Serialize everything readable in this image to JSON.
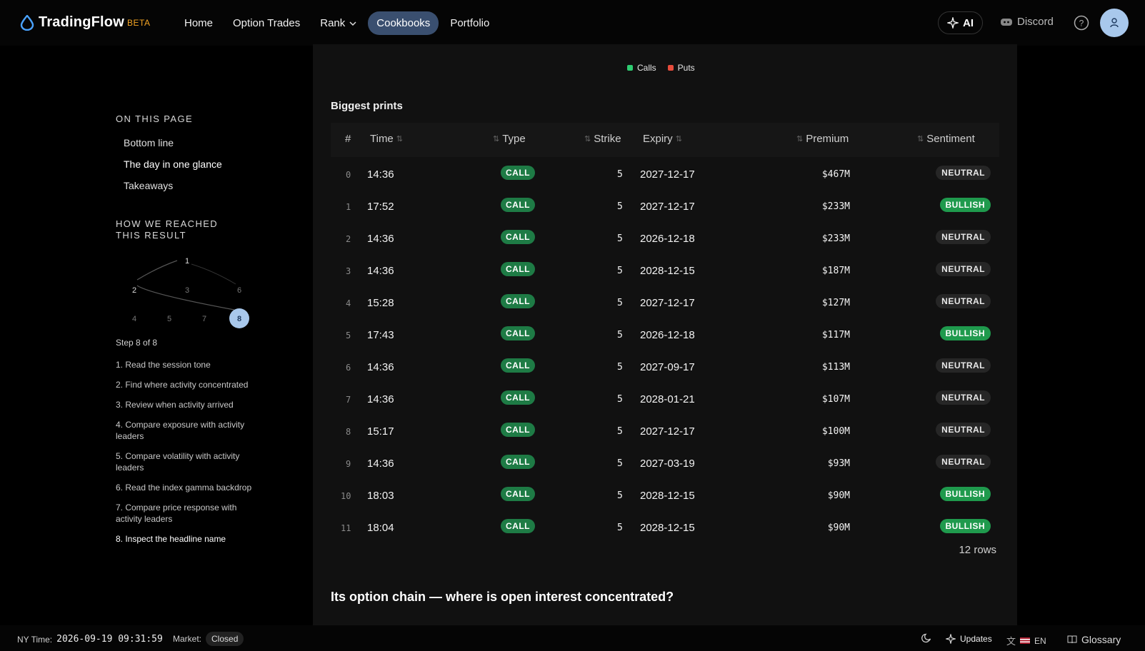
{
  "nav": {
    "brand": "TradingFlow",
    "beta": "BETA",
    "items": [
      "Home",
      "Option Trades",
      "Rank",
      "Cookbooks",
      "Portfolio"
    ],
    "ai_label": "AI",
    "discord_label": "Discord"
  },
  "sidebar": {
    "on_this_page": "ON THIS PAGE",
    "toc": [
      "Bottom line",
      "The day in one glance",
      "Takeaways"
    ],
    "how_we_reached": "HOW WE REACHED THIS RESULT",
    "graph_nodes": [
      "1",
      "2",
      "3",
      "6",
      "4",
      "5",
      "7",
      "8"
    ],
    "step_count": "Step 8 of 8",
    "steps": [
      "1.  Read the session tone",
      "2.  Find where activity concentrated",
      "3.  Review when activity arrived",
      "4.  Compare exposure with activity leaders",
      "5.  Compare volatility with activity leaders",
      "6.  Read the index gamma backdrop",
      "7.  Compare price response with activity leaders",
      "8.  Inspect the headline name"
    ]
  },
  "main": {
    "legend": [
      {
        "label": "Calls",
        "color": "#2ecc71"
      },
      {
        "label": "Puts",
        "color": "#e74c3c"
      }
    ],
    "section_title": "Biggest prints",
    "columns": [
      "#",
      "Time",
      "Type",
      "Strike",
      "Expiry",
      "Premium",
      "Sentiment"
    ],
    "rows": [
      {
        "idx": "0",
        "time": "14:36",
        "type": "CALL",
        "strike": "5",
        "expiry": "2027-12-17",
        "premium": "$467M",
        "sentiment": "NEUTRAL"
      },
      {
        "idx": "1",
        "time": "17:52",
        "type": "CALL",
        "strike": "5",
        "expiry": "2027-12-17",
        "premium": "$233M",
        "sentiment": "BULLISH"
      },
      {
        "idx": "2",
        "time": "14:36",
        "type": "CALL",
        "strike": "5",
        "expiry": "2026-12-18",
        "premium": "$233M",
        "sentiment": "NEUTRAL"
      },
      {
        "idx": "3",
        "time": "14:36",
        "type": "CALL",
        "strike": "5",
        "expiry": "2028-12-15",
        "premium": "$187M",
        "sentiment": "NEUTRAL"
      },
      {
        "idx": "4",
        "time": "15:28",
        "type": "CALL",
        "strike": "5",
        "expiry": "2027-12-17",
        "premium": "$127M",
        "sentiment": "NEUTRAL"
      },
      {
        "idx": "5",
        "time": "17:43",
        "type": "CALL",
        "strike": "5",
        "expiry": "2026-12-18",
        "premium": "$117M",
        "sentiment": "BULLISH"
      },
      {
        "idx": "6",
        "time": "14:36",
        "type": "CALL",
        "strike": "5",
        "expiry": "2027-09-17",
        "premium": "$113M",
        "sentiment": "NEUTRAL"
      },
      {
        "idx": "7",
        "time": "14:36",
        "type": "CALL",
        "strike": "5",
        "expiry": "2028-01-21",
        "premium": "$107M",
        "sentiment": "NEUTRAL"
      },
      {
        "idx": "8",
        "time": "15:17",
        "type": "CALL",
        "strike": "5",
        "expiry": "2027-12-17",
        "premium": "$100M",
        "sentiment": "NEUTRAL"
      },
      {
        "idx": "9",
        "time": "14:36",
        "type": "CALL",
        "strike": "5",
        "expiry": "2027-03-19",
        "premium": "$93M",
        "sentiment": "NEUTRAL"
      },
      {
        "idx": "10",
        "time": "18:03",
        "type": "CALL",
        "strike": "5",
        "expiry": "2028-12-15",
        "premium": "$90M",
        "sentiment": "BULLISH"
      },
      {
        "idx": "11",
        "time": "18:04",
        "type": "CALL",
        "strike": "5",
        "expiry": "2028-12-15",
        "premium": "$90M",
        "sentiment": "BULLISH"
      }
    ],
    "row_count": "12 rows",
    "next_section_title": "Its option chain — where is open interest concentrated?"
  },
  "footer": {
    "ny_time_label": "NY Time:",
    "ny_time_value": "2026-09-19 09:31:59",
    "market_label": "Market:",
    "market_status": "Closed",
    "updates_label": "Updates",
    "lang_label": "EN",
    "glossary_label": "Glossary"
  }
}
